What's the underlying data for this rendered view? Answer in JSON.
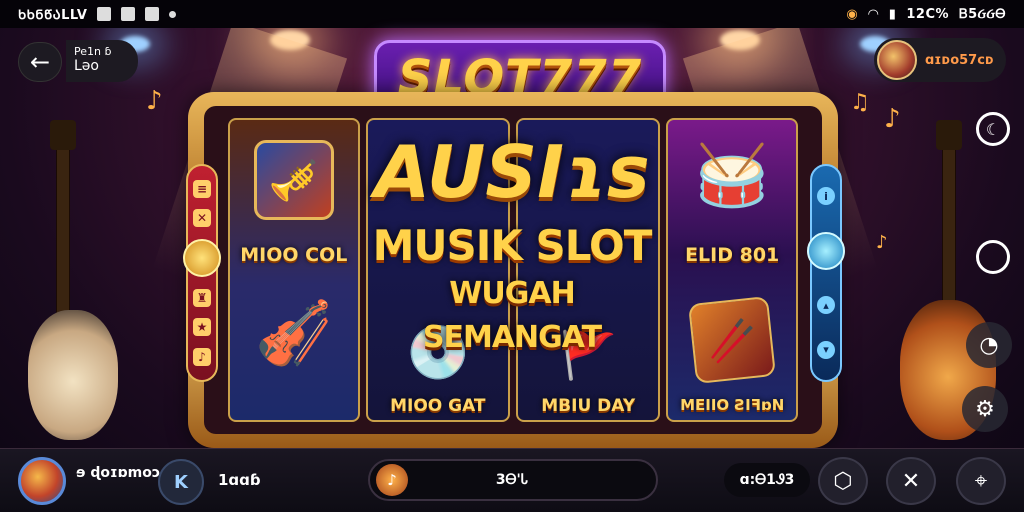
{
  "status_bar": {
    "left_text": "ᲮᲮᲜᲬᲐLLV",
    "right_text": "12C%",
    "time": "Ᏼ5ᏵᏵᎾ"
  },
  "top_left": {
    "back_icon": "arrow-left-icon",
    "line1": "Pe1n ɓ",
    "line2": "Lǝo"
  },
  "balance": {
    "value": "ɑɪᴅᴏ57ᴄᴅ"
  },
  "logo": {
    "text": "SLOT777"
  },
  "reels": {
    "r1_top_label": "MIOO COL",
    "r4_top_label": "ELID 801",
    "r2_bottom_label": "MIOO GAT",
    "r3_bottom_label": "MBIU DAY",
    "r4_bottom_label": "MEIIO ƧIꟻɒN"
  },
  "center_title": {
    "big": "AUSIɿs",
    "line2": "MUSIK SLOT",
    "line3": "WUGAH SEMANGAT"
  },
  "bottom_bar": {
    "username": "ɘ ɖoɪɒmoɔ",
    "k_label": "K",
    "count": "1ɑɑɓ",
    "center_value": "3Ꮎ'Ꮣ",
    "timer": "ɑ:Ꮎ1Ꮽ3"
  },
  "colors": {
    "gold": "#ffd24a",
    "logo_purple": "#6a1fb0",
    "balance_orange": "#ff9a4a",
    "frame_gold": "#e8b65a"
  }
}
